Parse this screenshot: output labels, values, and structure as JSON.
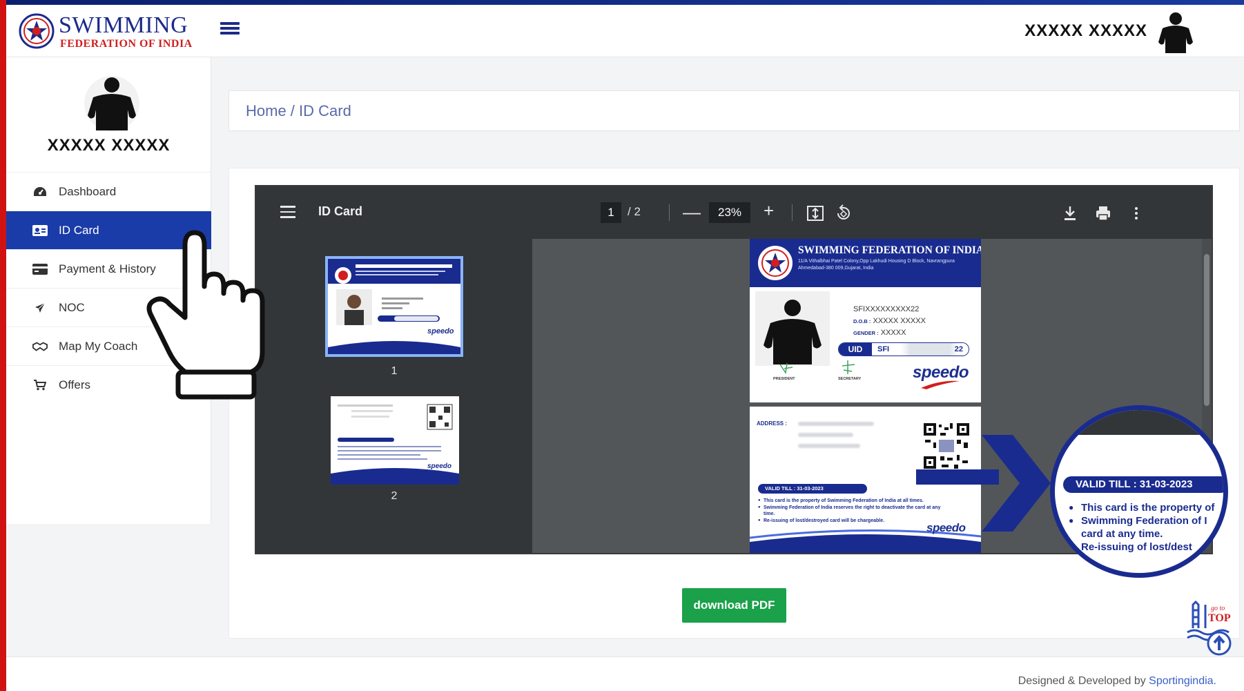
{
  "brand": {
    "title": "SWIMMING",
    "subtitle": "FEDERATION OF INDIA"
  },
  "header": {
    "user_name": "XXXXX XXXXX"
  },
  "sidebar": {
    "user_name": "XXXXX XXXXX",
    "items": [
      {
        "label": "Dashboard",
        "icon": "dashboard-icon"
      },
      {
        "label": "ID Card",
        "icon": "id-card-icon",
        "active": true
      },
      {
        "label": "Payment & History",
        "icon": "credit-card-icon"
      },
      {
        "label": "NOC",
        "icon": "plane-icon"
      },
      {
        "label": "Map My Coach",
        "icon": "handshake-icon"
      },
      {
        "label": "Offers",
        "icon": "cart-icon"
      }
    ]
  },
  "breadcrumb": {
    "text": "Home / ID Card"
  },
  "pdf_viewer": {
    "title": "ID Card",
    "current_page": "1",
    "total_pages": "2",
    "zoom": "23%",
    "thumbnails": [
      {
        "number": "1"
      },
      {
        "number": "2"
      }
    ]
  },
  "id_card": {
    "front": {
      "org_name": "SWIMMING FEDERATION OF INDIA",
      "address": "11/A Vithalbhai Patel Colony,Opp Lakhudi Housing D Block, Navrangpura Ahmedabad-380 009,Gujarat, India",
      "sfi_number": "SFIXXXXXXXXX22",
      "dob_label": "D.O.B :",
      "dob_value": "XXXXX XXXXX",
      "gender_label": "GENDER :",
      "gender_value": "XXXXX",
      "uid_label": "UID",
      "uid_prefix": "SFI",
      "uid_suffix": "22",
      "president_label": "PRESIDENT",
      "secretary_label": "SECRETARY",
      "sponsor": "speedo"
    },
    "back": {
      "address_label": "ADDRESS :",
      "valid_till": "VALID TILL : 31-03-2023",
      "bullets": [
        "This card is the property of Swimming Federation of India at all times.",
        "Swimming Federation of India reserves the right to deactivate the card at any time.",
        "Re-issuing of lost/destroyed card will be chargeable."
      ],
      "sponsor": "speedo"
    }
  },
  "zoom_callout": {
    "valid_till": "VALID TILL :  31-03-2023",
    "lines": [
      {
        "text": "This card is the property of",
        "bullet": true
      },
      {
        "text": "Swimming Federation of I",
        "bullet": true
      },
      {
        "text": "card at any time.",
        "bullet": false
      },
      {
        "text": "Re-issuing of lost/dest",
        "bullet": false
      }
    ]
  },
  "actions": {
    "download_label": "download PDF"
  },
  "gotop": {
    "label": "go to TOP"
  },
  "footer": {
    "prefix": "Designed & Developed by ",
    "link": "Sportingindia."
  },
  "colors": {
    "primary": "#1a3ca8",
    "brand_navy": "#1b2a8a",
    "brand_red": "#d21e1e",
    "download_green": "#1aa14a",
    "viewer_toolbar": "#323639",
    "viewer_bg": "#525659"
  }
}
